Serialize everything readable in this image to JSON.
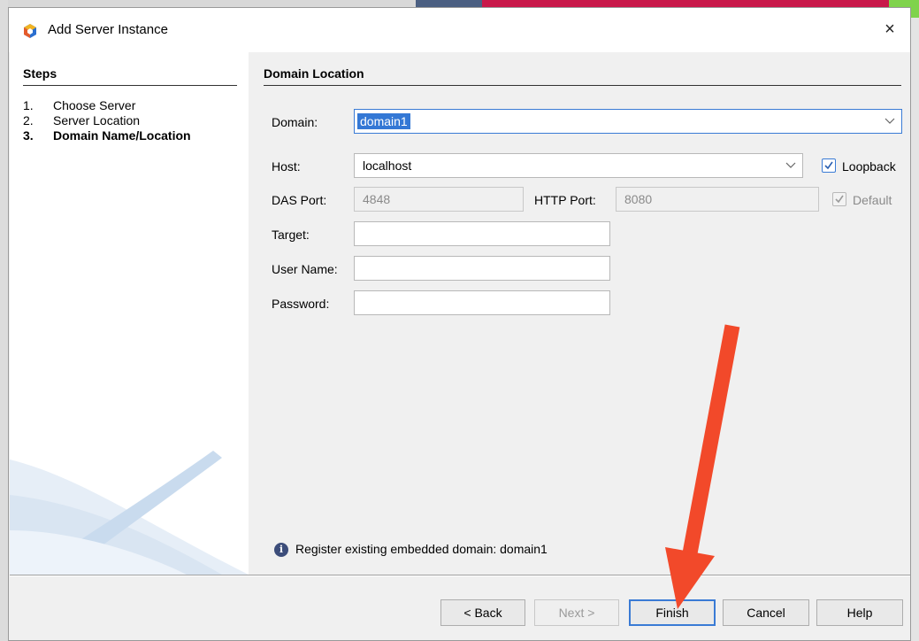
{
  "dialog": {
    "title": "Add Server Instance",
    "close_glyph": "×"
  },
  "steps": {
    "heading": "Steps",
    "items": [
      {
        "num": "1.",
        "label": "Choose Server"
      },
      {
        "num": "2.",
        "label": "Server Location"
      },
      {
        "num": "3.",
        "label": "Domain Name/Location"
      }
    ]
  },
  "form": {
    "section_title": "Domain Location",
    "domain_label": "Domain:",
    "domain_value": "domain1",
    "host_label": "Host:",
    "host_value": "localhost",
    "loopback_label": "Loopback",
    "das_port_label": "DAS Port:",
    "das_port_value": "4848",
    "http_port_label": "HTTP Port:",
    "http_port_value": "8080",
    "default_label": "Default",
    "target_label": "Target:",
    "target_value": "",
    "username_label": "User Name:",
    "username_value": "",
    "password_label": "Password:",
    "password_value": ""
  },
  "info": {
    "message": "Register existing embedded domain: domain1"
  },
  "buttons": {
    "back": "< Back",
    "next": "Next >",
    "finish": "Finish",
    "cancel": "Cancel",
    "help": "Help"
  },
  "icons": {
    "app": "netbeans-cube-icon",
    "info": "info-icon",
    "dropdown": "chevron-down-icon",
    "check": "check-icon"
  },
  "colors": {
    "accent": "#3a7bd5",
    "selection": "#3478d5",
    "annotation_arrow": "#f2492a"
  }
}
